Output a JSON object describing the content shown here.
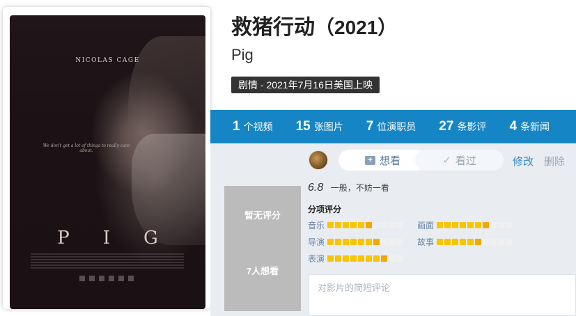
{
  "poster": {
    "actor": "NICOLAS CAGE",
    "tagline": "We don't get a lot of things to really care about.",
    "title": "PIG",
    "credits": "A FILM BY MICHAEL SARNOSKI"
  },
  "movie": {
    "title": "救猪行动",
    "year": "（2021）",
    "original_title": "Pig",
    "tag": "剧情 - 2021年7月16日美国上映"
  },
  "stats": [
    {
      "num": "1",
      "label": "个视频"
    },
    {
      "num": "15",
      "label": "张图片"
    },
    {
      "num": "7",
      "label": "位演职员"
    },
    {
      "num": "27",
      "label": "条影评"
    },
    {
      "num": "4",
      "label": "条新闻"
    }
  ],
  "actions": {
    "want_label": "想看",
    "seen_label": "看过",
    "edit_label": "修改",
    "delete_label": "删除"
  },
  "score_box": {
    "no_score": "暂无评分",
    "wanters": "7人想看"
  },
  "my_rating": {
    "value": "6.8",
    "desc": "一般，不妨一看"
  },
  "sub_ratings": {
    "title": "分项评分",
    "items": [
      {
        "label": "音乐",
        "filled": 6,
        "total": 10
      },
      {
        "label": "画面",
        "filled": 7,
        "total": 10
      },
      {
        "label": "导演",
        "filled": 7,
        "total": 10
      },
      {
        "label": "故事",
        "filled": 6,
        "total": 10
      },
      {
        "label": "表演",
        "filled": 8,
        "total": 10
      }
    ]
  },
  "comment": {
    "placeholder": "对影片的简短评论"
  },
  "colors": {
    "stats_bar": "#1685c5",
    "star": "#f9c400",
    "link": "#3a87c8"
  }
}
